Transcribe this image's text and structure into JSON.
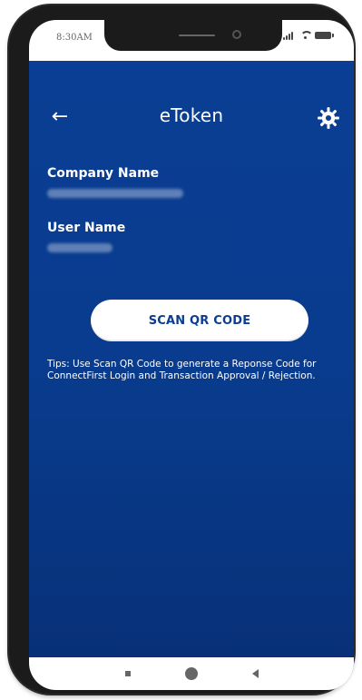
{
  "status_bar": {
    "time": "8:30AM"
  },
  "header": {
    "back_icon": "arrow-left-icon",
    "title": "eToken",
    "settings_icon": "gear-icon"
  },
  "fields": {
    "company_label": "Company Name",
    "user_label": "User Name"
  },
  "actions": {
    "scan_label": "SCAN QR CODE"
  },
  "tips": {
    "line1": "Tips: Use Scan QR Code to generate a Reponse Code for",
    "line2": "ConnectFirst Login and Transaction Approval / Rejection."
  },
  "colors": {
    "accent_blue": "#0a3f95",
    "button_text": "#0b3d92",
    "white": "#ffffff"
  }
}
